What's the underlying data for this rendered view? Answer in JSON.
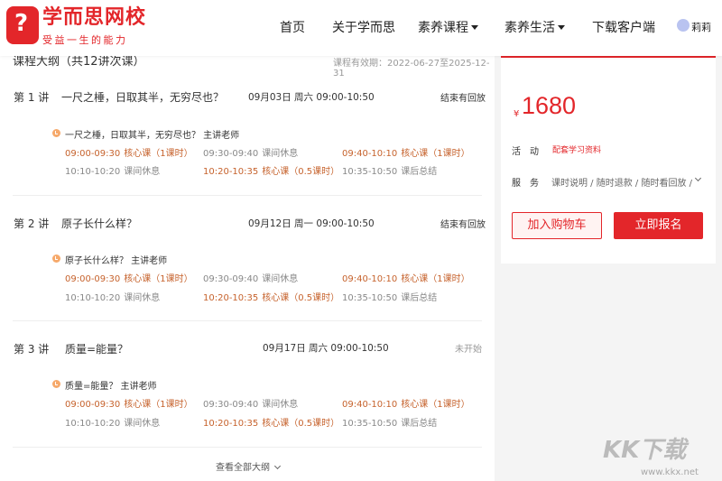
{
  "header": {
    "logo_title": "学而思网校",
    "logo_sub": "受益一生的能力",
    "nav": [
      "首页",
      "关于学而思",
      "素养课程",
      "素养生活",
      "下载客户端"
    ],
    "username": "莉莉"
  },
  "outline": {
    "title": "课程大纲（共12讲次课）",
    "validity": "课程有效期：2022-06-27至2025-12-31",
    "view_all": "查看全部大纲",
    "lectures": [
      {
        "num": "第 1 讲",
        "title": "一尺之棰，日取其半，无穷尽也？",
        "date": "09月03日 周六 09:00-10:50",
        "status": "结束有回放",
        "sub_title": "一尺之棰，日取其半，无穷尽也？ 主讲老师",
        "slots": [
          {
            "time": "09:00-09:30",
            "label": "核心课（1课时）"
          },
          {
            "time": "09:30-09:40",
            "label": "课间休息"
          },
          {
            "time": "09:40-10:10",
            "label": "核心课（1课时）"
          },
          {
            "time": "10:10-10:20",
            "label": "课间休息"
          },
          {
            "time": "10:20-10:35",
            "label": "核心课（0.5课时）"
          },
          {
            "time": "10:35-10:50",
            "label": "课后总结"
          }
        ]
      },
      {
        "num": "第 2 讲",
        "title": "原子长什么样？",
        "date": "09月12日 周一 09:00-10:50",
        "status": "结束有回放",
        "sub_title": "原子长什么样？ 主讲老师",
        "slots": [
          {
            "time": "09:00-09:30",
            "label": "核心课（1课时）"
          },
          {
            "time": "09:30-09:40",
            "label": "课间休息"
          },
          {
            "time": "09:40-10:10",
            "label": "核心课（1课时）"
          },
          {
            "time": "10:10-10:20",
            "label": "课间休息"
          },
          {
            "time": "10:20-10:35",
            "label": "核心课（0.5课时）"
          },
          {
            "time": "10:35-10:50",
            "label": "课后总结"
          }
        ]
      },
      {
        "num": "第 3 讲",
        "title": "质量=能量？",
        "date": "09月17日 周六 09:00-10:50",
        "status": "未开始",
        "sub_title": "质量=能量？ 主讲老师",
        "slots": [
          {
            "time": "09:00-09:30",
            "label": "核心课（1课时）"
          },
          {
            "time": "09:30-09:40",
            "label": "课间休息"
          },
          {
            "time": "09:40-10:10",
            "label": "核心课（1课时）"
          },
          {
            "time": "10:10-10:20",
            "label": "课间休息"
          },
          {
            "time": "10:20-10:35",
            "label": "核心课（0.5课时）"
          },
          {
            "time": "10:35-10:50",
            "label": "课后总结"
          }
        ]
      }
    ]
  },
  "purchase": {
    "currency": "¥",
    "price": "1680",
    "activity_label": "活动",
    "activity_link": "配套学习资料",
    "service_label": "服务",
    "service_text": "课时说明 / 随时退款 / 随时看回放 /",
    "cart_button": "加入购物车",
    "enroll_button": "立即报名"
  },
  "watermark": {
    "big": "KK下载",
    "small": "www.kkx.net"
  },
  "colors": {
    "brand": "#e3262a",
    "highlight_slot": "#c6622c"
  }
}
